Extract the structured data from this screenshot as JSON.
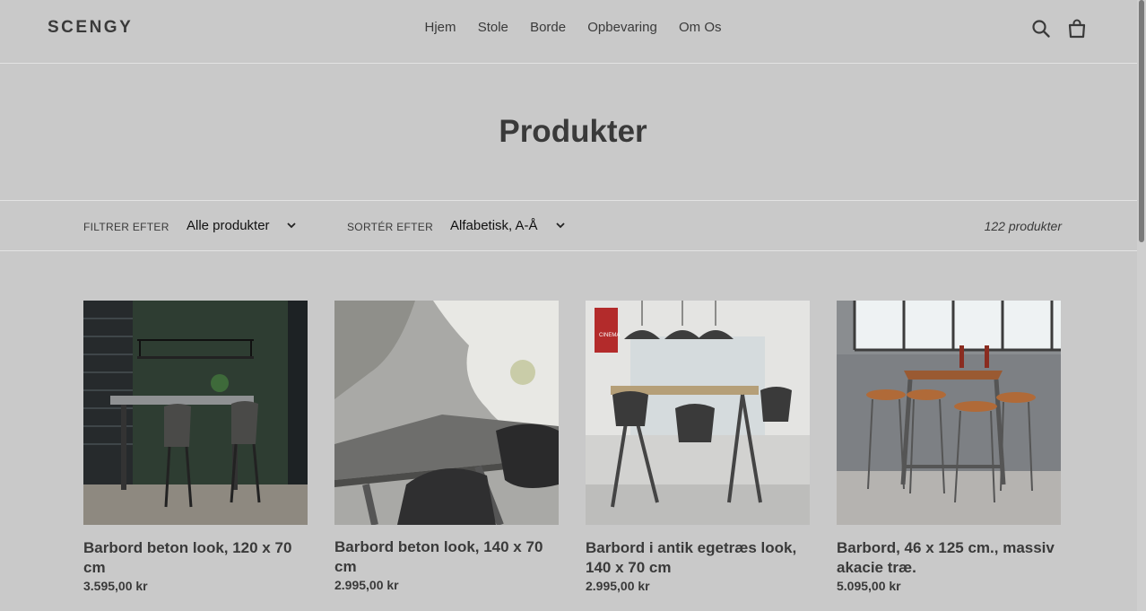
{
  "brand": "SCENGY",
  "nav": [
    "Hjem",
    "Stole",
    "Borde",
    "Opbevaring",
    "Om Os"
  ],
  "header_icons": [
    "search-icon",
    "cart-icon"
  ],
  "page_title": "Produkter",
  "filter": {
    "label": "FILTRER EFTER",
    "value": "Alle produkter"
  },
  "sort": {
    "label": "SORTÉR EFTER",
    "value": "Alfabetisk, A-Å"
  },
  "product_count": "122 produkter",
  "products": [
    {
      "name": "Barbord beton look, 120 x 70 cm",
      "price": "3.595,00 kr"
    },
    {
      "name": "Barbord beton look, 140 x 70 cm",
      "price": "2.995,00 kr"
    },
    {
      "name": "Barbord i antik egetræs look, 140 x 70 cm",
      "price": "2.995,00 kr"
    },
    {
      "name": "Barbord, 46 x 125 cm., massiv akacie træ.",
      "price": "5.095,00 kr"
    }
  ],
  "poster_text": "CINEMA",
  "colors": {
    "background": "#c9c9c9",
    "text": "#3a3a3a",
    "divider": "#e3e3e3"
  }
}
